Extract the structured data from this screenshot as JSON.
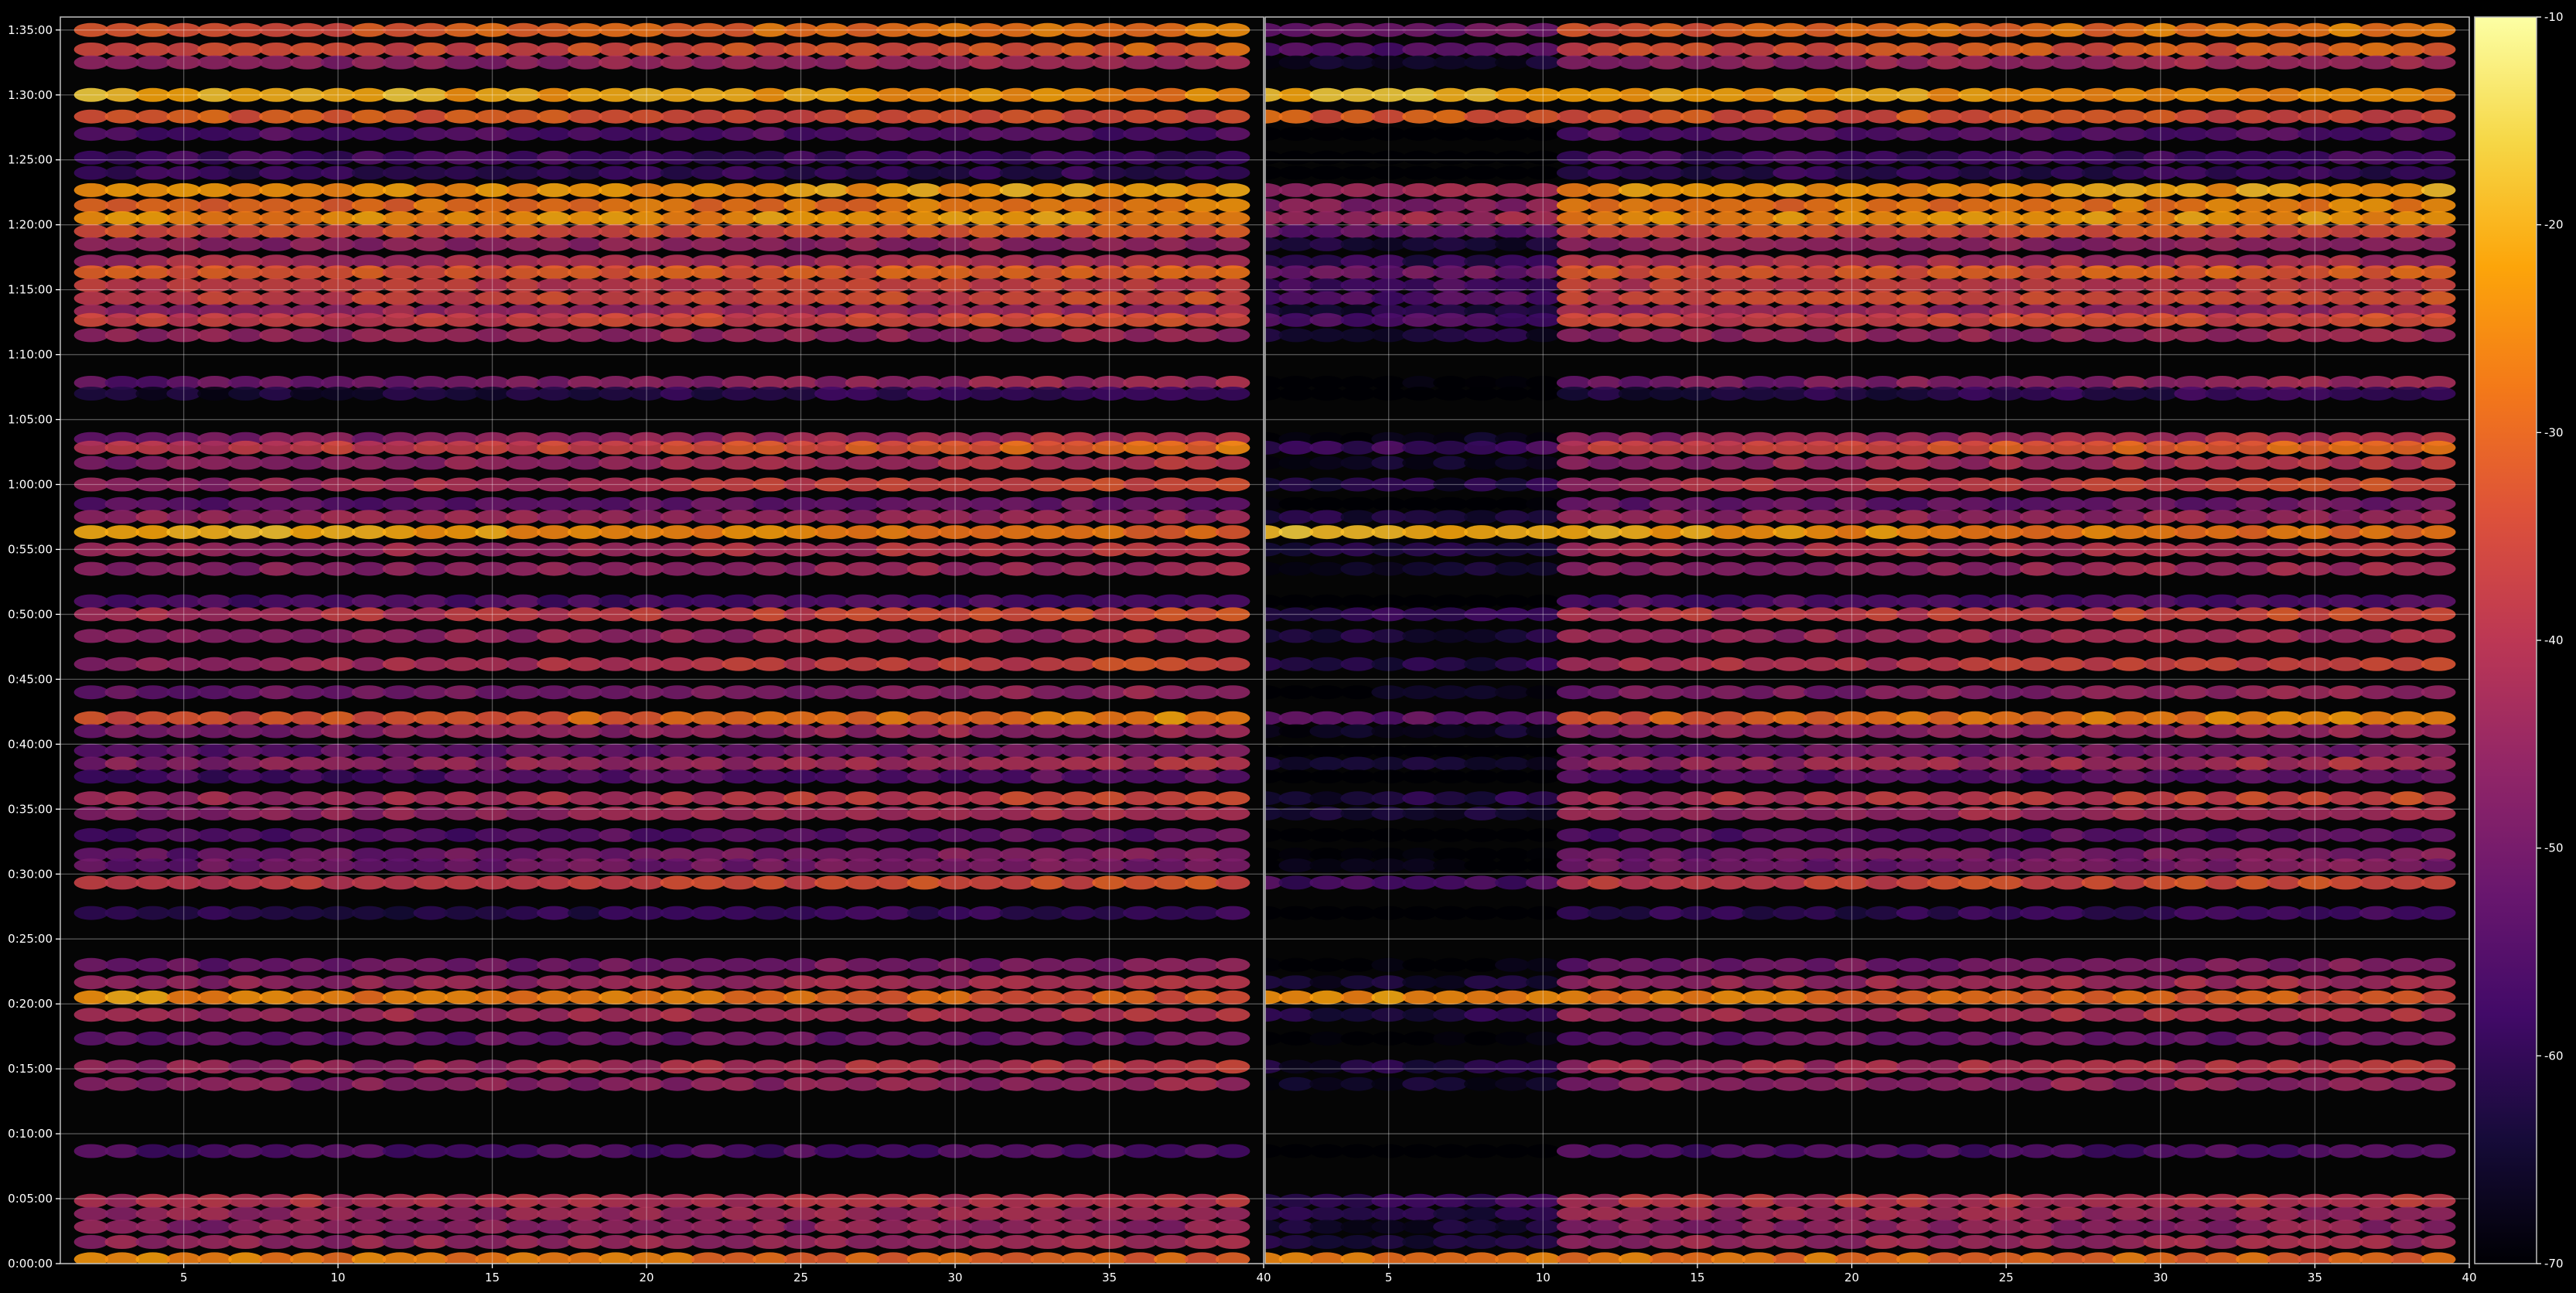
{
  "chart_data": {
    "type": "heatmap",
    "title": "",
    "xlabel": "",
    "ylabel": "",
    "background": "#000000",
    "gridlines": true,
    "colormap": "inferno",
    "colorbar": {
      "placement": "right",
      "range": [
        -70,
        -10
      ],
      "ticks": [
        "-10",
        "-20",
        "-30",
        "-40",
        "-50",
        "-60",
        "-70"
      ]
    },
    "y_axis": {
      "range": [
        "0:00:00",
        "1:36:00"
      ],
      "ticks": [
        "1:35:00",
        "1:30:00",
        "1:25:00",
        "1:20:00",
        "1:15:00",
        "1:10:00",
        "1:05:00",
        "1:00:00",
        "0:55:00",
        "0:50:00",
        "0:45:00",
        "0:40:00",
        "0:35:00",
        "0:30:00",
        "0:25:00",
        "0:20:00",
        "0:15:00",
        "0:10:00",
        "0:05:00",
        "0:00:00"
      ]
    },
    "panels": [
      {
        "name": "left",
        "x_range": [
          1,
          40
        ],
        "x_ticks": [
          "5",
          "10",
          "15",
          "20",
          "25",
          "30",
          "35",
          "40"
        ],
        "x_extent": [
          2,
          39
        ]
      },
      {
        "name": "right",
        "x_range": [
          1,
          40
        ],
        "x_ticks": [
          "5",
          "10",
          "15",
          "20",
          "25",
          "30",
          "35",
          "40"
        ],
        "x_extent": [
          1,
          39
        ],
        "quiet_range": [
          1,
          10
        ]
      }
    ],
    "bands": [
      {
        "t": "1:35:00",
        "level": -30,
        "drift": 5
      },
      {
        "t": "1:33:30",
        "level": -34,
        "drift": 4
      },
      {
        "t": "1:32:30",
        "level": -45,
        "drift": 3
      },
      {
        "t": "1:30:00",
        "level": -22,
        "drift": -4
      },
      {
        "t": "1:28:20",
        "level": -33,
        "drift": -2
      },
      {
        "t": "1:27:00",
        "level": -55,
        "drift": 0
      },
      {
        "t": "1:25:10",
        "level": -58,
        "drift": 0
      },
      {
        "t": "1:24:00",
        "level": -60,
        "drift": 0
      },
      {
        "t": "1:22:40",
        "level": -23,
        "drift": 2
      },
      {
        "t": "1:21:30",
        "level": -28,
        "drift": 2
      },
      {
        "t": "1:20:30",
        "level": -24,
        "drift": 1
      },
      {
        "t": "1:19:30",
        "level": -34,
        "drift": 1
      },
      {
        "t": "1:18:30",
        "level": -46,
        "drift": 0
      },
      {
        "t": "1:17:10",
        "level": -42,
        "drift": 0
      },
      {
        "t": "1:16:20",
        "level": -32,
        "drift": 1
      },
      {
        "t": "1:15:20",
        "level": -38,
        "drift": 1
      },
      {
        "t": "1:14:20",
        "level": -36,
        "drift": 2
      },
      {
        "t": "1:13:20",
        "level": -44,
        "drift": 1
      },
      {
        "t": "1:12:40",
        "level": -36,
        "drift": 2
      },
      {
        "t": "1:11:30",
        "level": -45,
        "drift": 1
      },
      {
        "t": "1:07:50",
        "level": -48,
        "drift": 6
      },
      {
        "t": "1:07:00",
        "level": -62,
        "drift": 4
      },
      {
        "t": "1:03:30",
        "level": -45,
        "drift": 6
      },
      {
        "t": "1:02:50",
        "level": -35,
        "drift": 7
      },
      {
        "t": "1:01:40",
        "level": -44,
        "drift": 5
      },
      {
        "t": "1:00:00",
        "level": -40,
        "drift": 7
      },
      {
        "t": "0:58:30",
        "level": -52,
        "drift": 2
      },
      {
        "t": "0:57:30",
        "level": -45,
        "drift": 0
      },
      {
        "t": "0:56:20",
        "level": -24,
        "drift": -6
      },
      {
        "t": "0:55:00",
        "level": -42,
        "drift": 4
      },
      {
        "t": "0:53:30",
        "level": -45,
        "drift": 3
      },
      {
        "t": "0:51:00",
        "level": -56,
        "drift": 0
      },
      {
        "t": "0:50:00",
        "level": -38,
        "drift": 4
      },
      {
        "t": "0:48:20",
        "level": -44,
        "drift": 2
      },
      {
        "t": "0:46:10",
        "level": -40,
        "drift": 6
      },
      {
        "t": "0:44:00",
        "level": -48,
        "drift": 4
      },
      {
        "t": "0:42:00",
        "level": -30,
        "drift": 6
      },
      {
        "t": "0:41:00",
        "level": -46,
        "drift": 3
      },
      {
        "t": "0:39:30",
        "level": -52,
        "drift": 4
      },
      {
        "t": "0:38:30",
        "level": -44,
        "drift": 4
      },
      {
        "t": "0:37:30",
        "level": -55,
        "drift": 3
      },
      {
        "t": "0:35:50",
        "level": -40,
        "drift": 6
      },
      {
        "t": "0:34:40",
        "level": -44,
        "drift": 4
      },
      {
        "t": "0:33:00",
        "level": -54,
        "drift": 2
      },
      {
        "t": "0:31:30",
        "level": -50,
        "drift": 3
      },
      {
        "t": "0:30:40",
        "level": -50,
        "drift": 2
      },
      {
        "t": "0:29:20",
        "level": -36,
        "drift": 3
      },
      {
        "t": "0:27:00",
        "level": -60,
        "drift": 2
      },
      {
        "t": "0:23:00",
        "level": -50,
        "drift": 3
      },
      {
        "t": "0:21:40",
        "level": -44,
        "drift": 3
      },
      {
        "t": "0:20:30",
        "level": -28,
        "drift": -5
      },
      {
        "t": "0:19:10",
        "level": -42,
        "drift": 2
      },
      {
        "t": "0:17:20",
        "level": -52,
        "drift": 1
      },
      {
        "t": "0:15:10",
        "level": -42,
        "drift": 4
      },
      {
        "t": "0:13:50",
        "level": -46,
        "drift": 2
      },
      {
        "t": "0:08:40",
        "level": -56,
        "drift": 0
      },
      {
        "t": "0:04:50",
        "level": -40,
        "drift": 1
      },
      {
        "t": "0:03:50",
        "level": -44,
        "drift": 1
      },
      {
        "t": "0:02:50",
        "level": -46,
        "drift": 1
      },
      {
        "t": "0:01:40",
        "level": -44,
        "drift": 1
      },
      {
        "t": "0:00:20",
        "level": -28,
        "drift": -3
      }
    ]
  }
}
